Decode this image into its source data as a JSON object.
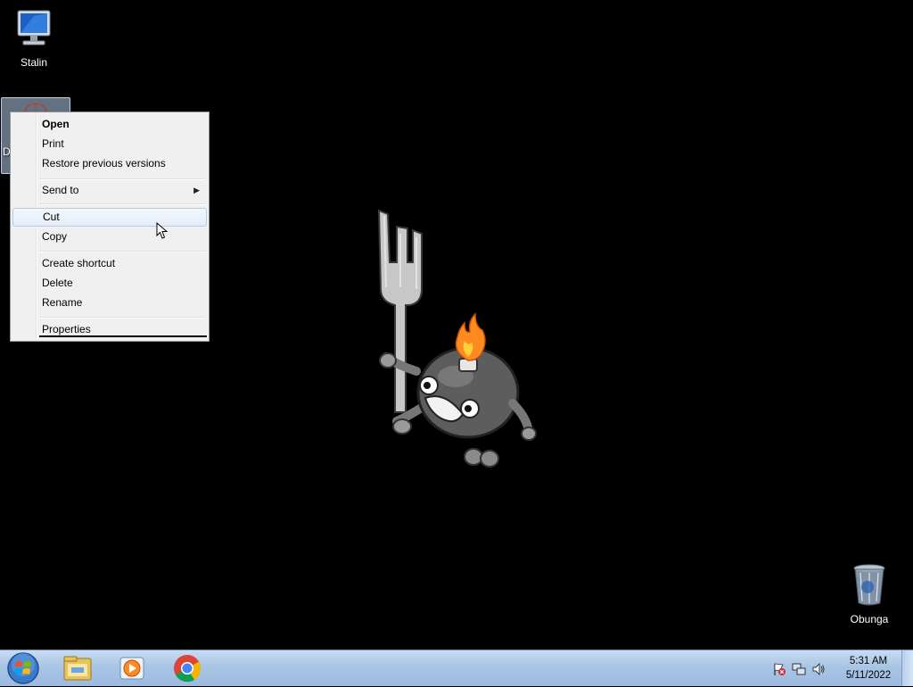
{
  "desktop": {
    "icons": [
      {
        "label": "Stalin",
        "icon": "computer-icon"
      },
      {
        "label": "D",
        "icon": "document-icon"
      },
      {
        "label": "Obunga",
        "icon": "recycle-bin-icon"
      }
    ],
    "wallpaper": "bomb-mascot-holding-fork"
  },
  "context_menu": {
    "items": [
      {
        "label": "Open",
        "bold": true
      },
      {
        "label": "Print"
      },
      {
        "label": "Restore previous versions"
      },
      {
        "label": "Send to",
        "submenu": true
      },
      {
        "label": "Cut",
        "highlighted": true
      },
      {
        "label": "Copy"
      },
      {
        "label": "Create shortcut"
      },
      {
        "label": "Delete"
      },
      {
        "label": "Rename"
      },
      {
        "label": "Properties"
      }
    ]
  },
  "taskbar": {
    "pinned": [
      "windows-start-icon",
      "file-explorer-icon",
      "media-player-icon",
      "chrome-icon"
    ],
    "tray_icons": [
      "action-center-flag-icon",
      "network-icon",
      "volume-icon"
    ],
    "time": "5:31 AM",
    "date": "5/11/2022"
  },
  "colors": {
    "desktop_bg": "#000000",
    "menu_bg": "#f0f0f0",
    "taskbar": "#a9c5e5",
    "flame": "#ff8a1f"
  }
}
